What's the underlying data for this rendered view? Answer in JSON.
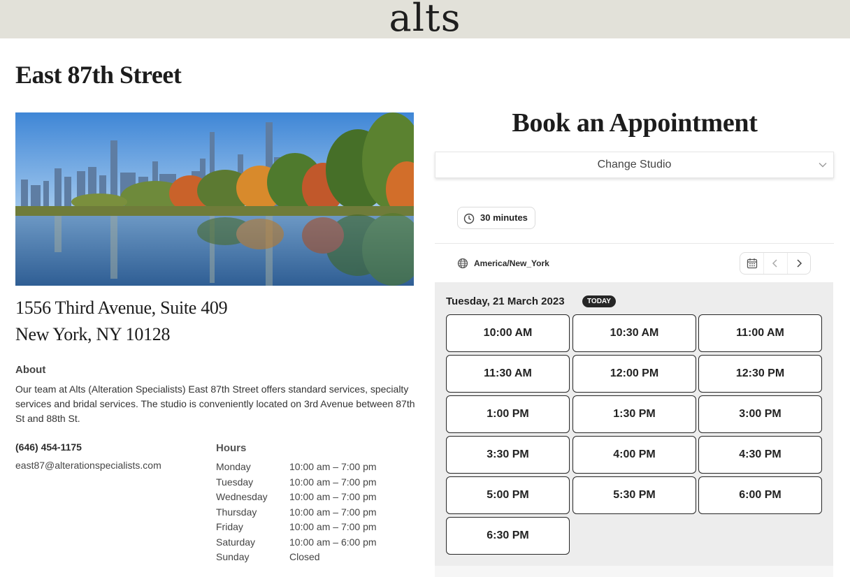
{
  "brand": {
    "logo_text": "alts"
  },
  "studio": {
    "title": "East 87th Street",
    "address_line1": "1556 Third Avenue, Suite 409",
    "address_line2": "New York, NY 10128",
    "about_heading": "About",
    "about_text": "Our team at Alts (Alteration Specialists) East 87th Street offers standard services, specialty services and bridal services. The studio is conveniently located on 3rd Avenue between 87th St and 88th St.",
    "phone": "(646) 454-1175",
    "email": "east87@alterationspecialists.com",
    "hours_heading": "Hours",
    "hours": [
      {
        "day": "Monday",
        "time": "10:00 am – 7:00 pm"
      },
      {
        "day": "Tuesday",
        "time": "10:00 am – 7:00 pm"
      },
      {
        "day": "Wednesday",
        "time": "10:00 am – 7:00 pm"
      },
      {
        "day": "Thursday",
        "time": "10:00 am – 7:00 pm"
      },
      {
        "day": "Friday",
        "time": "10:00 am – 7:00 pm"
      },
      {
        "day": "Saturday",
        "time": "10:00 am – 6:00 pm"
      },
      {
        "day": "Sunday",
        "time": "Closed"
      }
    ]
  },
  "booking": {
    "title": "Book an Appointment",
    "change_studio_label": "Change Studio",
    "duration": "30 minutes",
    "timezone": "America/New_York",
    "date_label": "Tuesday, 21 March 2023",
    "today_badge": "TODAY",
    "slots": [
      "10:00 AM",
      "10:30 AM",
      "11:00 AM",
      "11:30 AM",
      "12:00 PM",
      "12:30 PM",
      "1:00 PM",
      "1:30 PM",
      "3:00 PM",
      "3:30 PM",
      "4:00 PM",
      "4:30 PM",
      "5:00 PM",
      "5:30 PM",
      "6:00 PM",
      "6:30 PM"
    ]
  },
  "icons": {
    "clock": "clock-icon",
    "globe": "globe-icon",
    "calendar": "calendar-icon",
    "prev": "chevron-left-icon",
    "next": "chevron-right-icon",
    "dropdown": "chevron-down-icon"
  },
  "colors": {
    "topbar_bg": "#e2e1d9",
    "slots_panel_bg": "#ededed",
    "slot_border": "#262626",
    "today_badge_bg": "#262626"
  }
}
